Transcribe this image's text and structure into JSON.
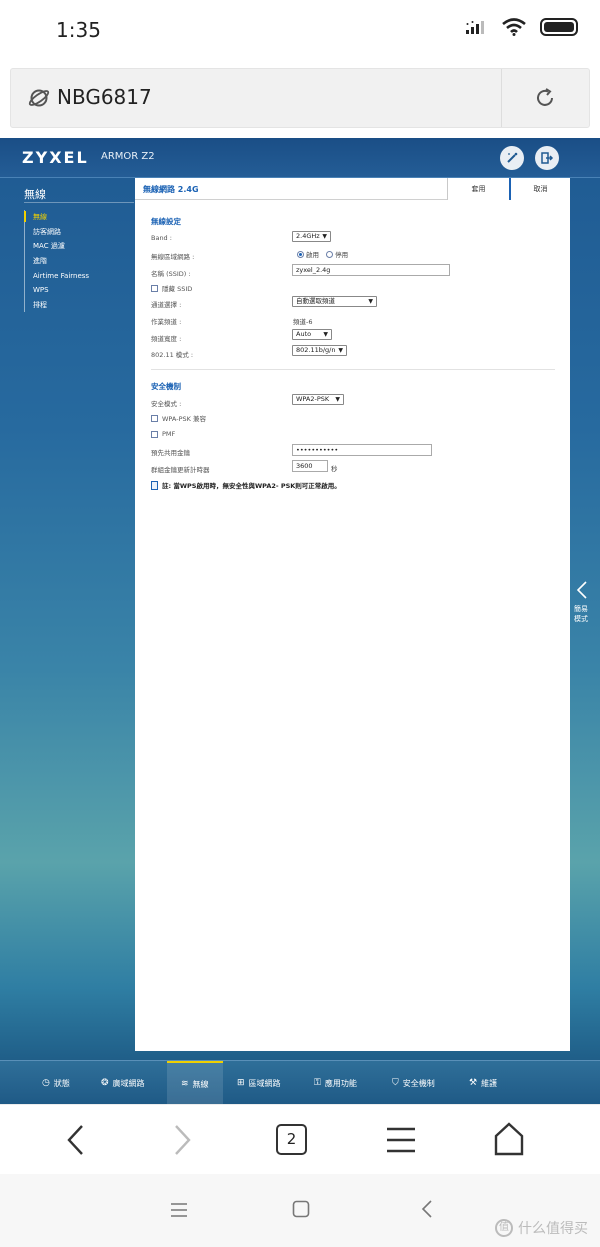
{
  "status": {
    "time": "1:35"
  },
  "browser": {
    "url": "NBG6817",
    "tab_count": "2"
  },
  "router": {
    "brand": "ZYXEL",
    "model": "ARMOR Z2",
    "sidebar": {
      "title": "無線",
      "items": [
        "無線",
        "訪客網路",
        "MAC 過濾",
        "進階",
        "Airtime Fairness",
        "WPS",
        "排程"
      ]
    },
    "panel": {
      "title": "無線網路 2.4G",
      "apply": "套用",
      "cancel": "取消"
    },
    "wireless": {
      "section": "無線設定",
      "band_label": "Band :",
      "band_value": "2.4GHz",
      "network_label": "無線區域網路 :",
      "enable": "啟用",
      "disable": "停用",
      "ssid_label": "名稱 (SSID) :",
      "ssid_value": "zyxel_2.4g",
      "hide_ssid": "隱藏 SSID",
      "channel_select_label": "通道選擇 :",
      "channel_select_value": "自動選取頻道",
      "op_channel_label": "作業頻道 :",
      "op_channel_value": "頻道-6",
      "bandwidth_label": "頻道寬度 :",
      "bandwidth_value": "Auto",
      "mode_label": "802.11 模式 :",
      "mode_value": "802.11b/g/n"
    },
    "security": {
      "section": "安全機制",
      "mode_label": "安全模式 :",
      "mode_value": "WPA2-PSK",
      "wpa_compat": "WPA-PSK 兼容",
      "pmf": "PMF",
      "psk_label": "預先共用金鑰",
      "psk_value": "•••••••••••",
      "rekey_label": "群組金鑰更新計時器",
      "rekey_value": "3600",
      "rekey_unit": "秒",
      "note": "註: 當WPS啟用時，無安全性與WPA2- PSK則可正常啟用。"
    },
    "side_tab": "簡易模式",
    "nav": {
      "status": "狀態",
      "wan": "廣域網路",
      "wireless": "無線",
      "lan": "區域網路",
      "apps": "應用功能",
      "security": "安全機制",
      "maintenance": "維護"
    }
  },
  "watermark": "什么值得买"
}
